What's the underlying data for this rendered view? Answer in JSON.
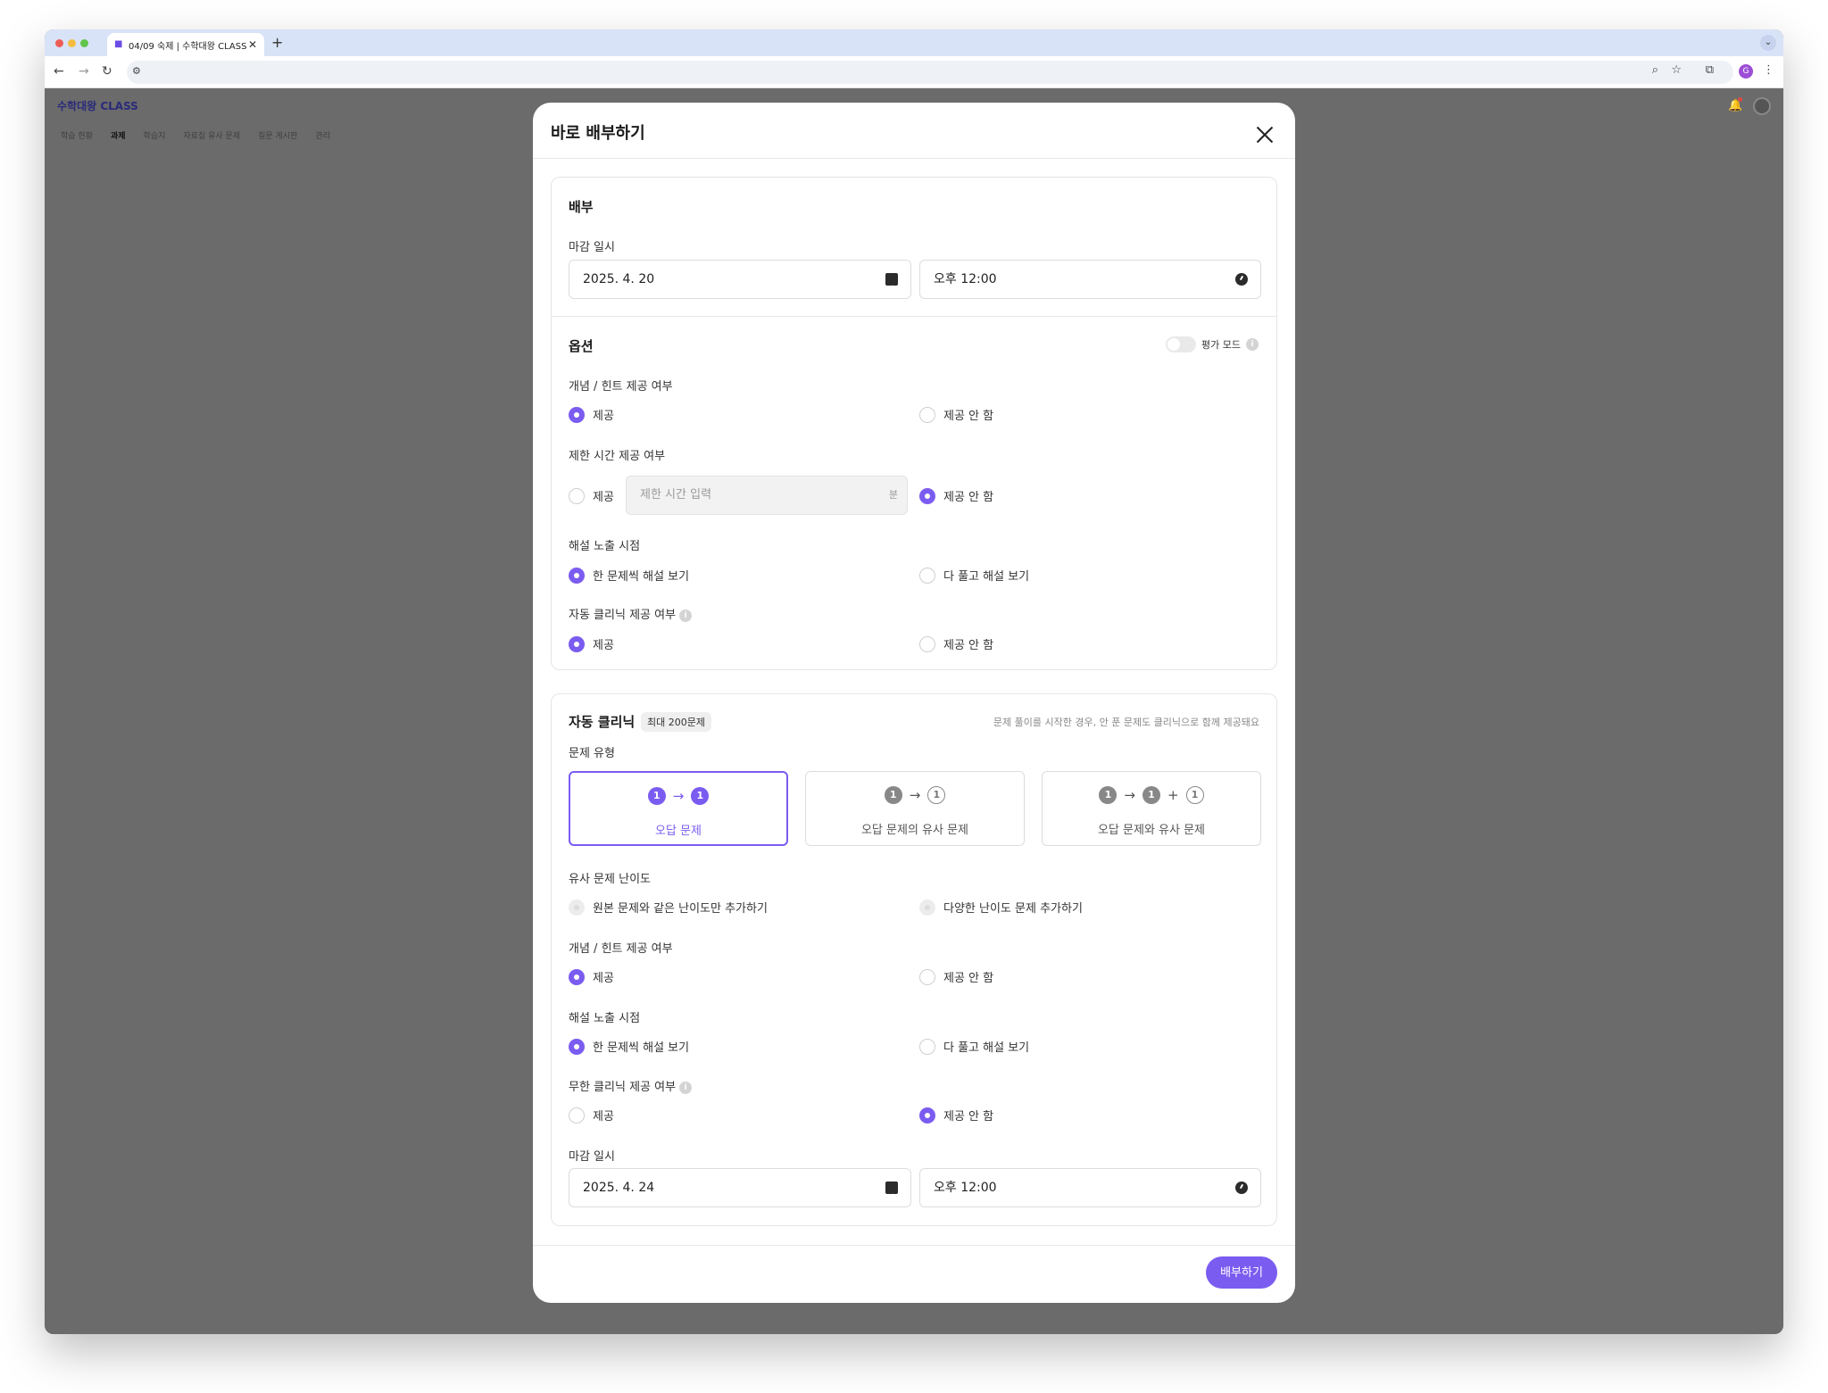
{
  "browser": {
    "tab_title": "04/09 숙제 | 수학대왕 CLASS",
    "tab_close": "✕",
    "new_tab": "+",
    "profile_initial": "G"
  },
  "app": {
    "logo": "수학대왕 CLASS",
    "nav": [
      "학습 현황",
      "과제",
      "학습지",
      "자료집 유사 문제",
      "질문 게시판",
      "관리"
    ],
    "active_nav_index": 1
  },
  "modal": {
    "title": "바로 배부하기",
    "distribution": {
      "section_title": "배부",
      "deadline_label": "마감 일시",
      "date": "2025. 4. 20",
      "time": "오후 12:00"
    },
    "options": {
      "section_title": "옵션",
      "eval_mode_label": "평가 모드",
      "eval_mode_on": false,
      "concept_hint": {
        "label": "개념 / 힌트 제공 여부",
        "opt_yes": "제공",
        "opt_no": "제공 안 함",
        "selected": "yes"
      },
      "time_limit": {
        "label": "제한 시간 제공 여부",
        "opt_yes": "제공",
        "opt_no": "제공 안 함",
        "placeholder": "제한 시간 입력",
        "unit": "분",
        "selected": "no"
      },
      "solution_timing": {
        "label": "해설 노출 시점",
        "opt_a": "한 문제씩 해설 보기",
        "opt_b": "다 풀고 해설 보기",
        "selected": "a"
      },
      "auto_clinic": {
        "label": "자동 클리닉 제공 여부",
        "opt_yes": "제공",
        "opt_no": "제공 안 함",
        "selected": "yes"
      }
    },
    "clinic": {
      "section_title": "자동 클리닉",
      "badge": "최대 200문제",
      "note": "문제 풀이를 시작한 경우, 안 푼 문제도 클리닉으로 함께 제공돼요",
      "type_label": "문제 유형",
      "types": [
        {
          "label": "오답 문제",
          "selected": true
        },
        {
          "label": "오답 문제의 유사 문제",
          "selected": false
        },
        {
          "label": "오답 문제와 유사 문제",
          "selected": false
        }
      ],
      "type_num": "1",
      "type_arrow": "→",
      "type_plus": "+",
      "difficulty": {
        "label": "유사 문제 난이도",
        "opt_a": "원본 문제와 같은 난이도만 추가하기",
        "opt_b": "다양한 난이도 문제 추가하기",
        "disabled": true
      },
      "concept_hint": {
        "label": "개념 / 힌트 제공 여부",
        "opt_yes": "제공",
        "opt_no": "제공 안 함",
        "selected": "yes"
      },
      "solution_timing": {
        "label": "해설 노출 시점",
        "opt_a": "한 문제씩 해설 보기",
        "opt_b": "다 풀고 해설 보기",
        "selected": "a"
      },
      "infinite_clinic": {
        "label": "무한 클리닉 제공 여부",
        "opt_yes": "제공",
        "opt_no": "제공 안 함",
        "selected": "no"
      },
      "deadline_label": "마감 일시",
      "date": "2025. 4. 24",
      "time": "오후 12:00"
    },
    "submit_label": "배부하기"
  },
  "colors": {
    "accent": "#7b5cf0",
    "overlay": "#6b6b6b"
  }
}
